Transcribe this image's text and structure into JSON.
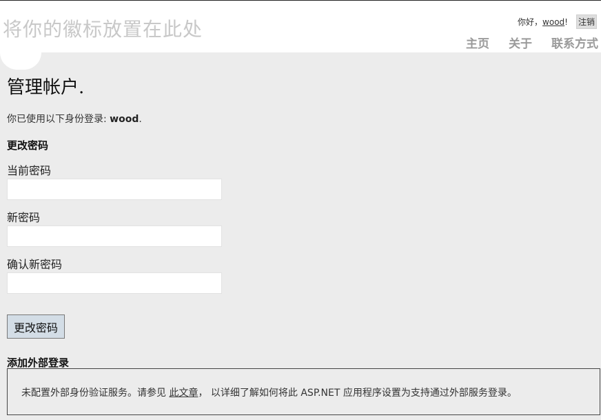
{
  "header": {
    "logo_text": "将你的徽标放置在此处",
    "greeting_prefix": "你好，",
    "username": "wood",
    "greeting_suffix": "!",
    "logout_label": "注销",
    "nav": [
      "主页",
      "关于",
      "联系方式"
    ]
  },
  "main": {
    "title": "管理帐户.",
    "login_info_prefix": "你已使用以下身份登录: ",
    "login_info_user": "wood",
    "login_info_suffix": ".",
    "change_password_heading": "更改密码",
    "current_password_label": "当前密码",
    "current_password_value": "",
    "new_password_label": "新密码",
    "new_password_value": "",
    "confirm_password_label": "确认新密码",
    "confirm_password_value": "",
    "submit_label": "更改密码",
    "external_login_heading": "添加外部登录",
    "notice_prefix": "未配置外部身份验证服务。请参见 ",
    "notice_link": "此文章",
    "notice_suffix": "， 以详细了解如何将此 ASP.NET 应用程序设置为支持通过外部服务登录。"
  }
}
